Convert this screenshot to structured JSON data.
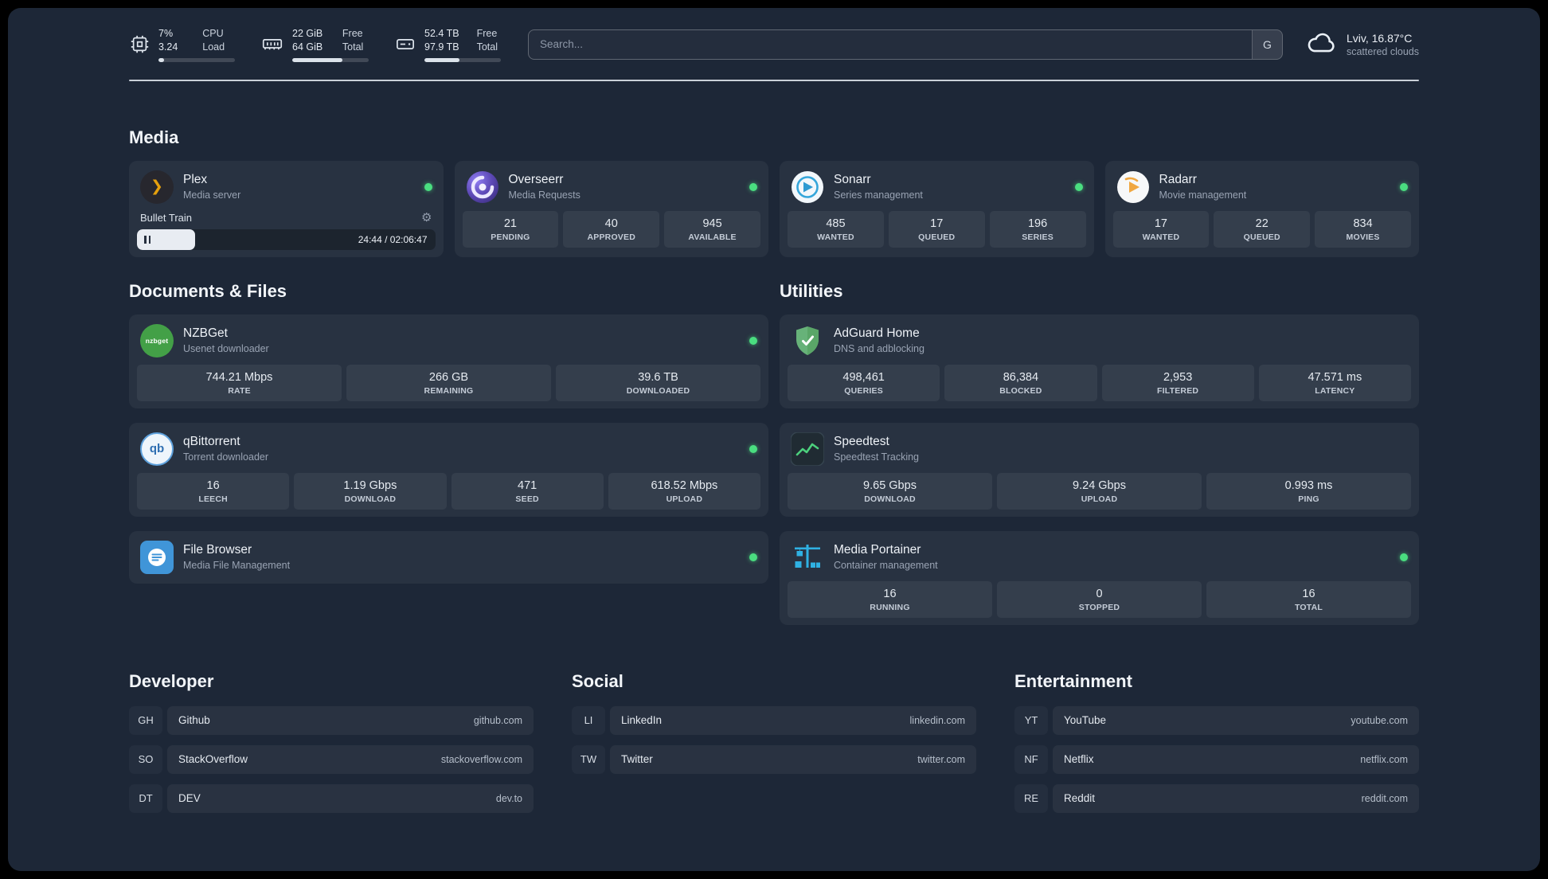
{
  "topbar": {
    "resources": [
      {
        "icon": "cpu-icon",
        "line1": "7%",
        "line2": "3.24",
        "label1": "CPU",
        "label2": "Load",
        "bar_pct": 7
      },
      {
        "icon": "ram-icon",
        "line1": "22 GiB",
        "line2": "64 GiB",
        "label1": "Free",
        "label2": "Total",
        "bar_pct": 66
      },
      {
        "icon": "disk-icon",
        "line1": "52.4 TB",
        "line2": "97.9 TB",
        "label1": "Free",
        "label2": "Total",
        "bar_pct": 46
      }
    ],
    "search": {
      "placeholder": "Search...",
      "provider_label": "G"
    },
    "weather": {
      "icon": "cloud-icon",
      "location": "Lviv, 16.87°C",
      "condition": "scattered clouds"
    }
  },
  "media": {
    "title": "Media",
    "plex": {
      "icon": "plex-icon",
      "name": "Plex",
      "subtitle": "Media server",
      "status": "online",
      "player": {
        "title": "Bullet Train",
        "time": "24:44 / 02:06:47",
        "progress_pct": 19.5
      }
    },
    "overseerr": {
      "icon": "overseerr-icon",
      "name": "Overseerr",
      "subtitle": "Media Requests",
      "status": "online",
      "stats": [
        {
          "value": "21",
          "label": "PENDING"
        },
        {
          "value": "40",
          "label": "APPROVED"
        },
        {
          "value": "945",
          "label": "AVAILABLE"
        }
      ]
    },
    "sonarr": {
      "icon": "sonarr-icon",
      "name": "Sonarr",
      "subtitle": "Series management",
      "status": "online",
      "stats": [
        {
          "value": "485",
          "label": "WANTED"
        },
        {
          "value": "17",
          "label": "QUEUED"
        },
        {
          "value": "196",
          "label": "SERIES"
        }
      ]
    },
    "radarr": {
      "icon": "radarr-icon",
      "name": "Radarr",
      "subtitle": "Movie management",
      "status": "online",
      "stats": [
        {
          "value": "17",
          "label": "WANTED"
        },
        {
          "value": "22",
          "label": "QUEUED"
        },
        {
          "value": "834",
          "label": "MOVIES"
        }
      ]
    }
  },
  "documents": {
    "title": "Documents & Files",
    "nzbget": {
      "icon": "nzbget-icon",
      "icon_text": "nzbget",
      "name": "NZBGet",
      "subtitle": "Usenet downloader",
      "status": "online",
      "stats": [
        {
          "value": "744.21 Mbps",
          "label": "RATE"
        },
        {
          "value": "266 GB",
          "label": "REMAINING"
        },
        {
          "value": "39.6 TB",
          "label": "DOWNLOADED"
        }
      ]
    },
    "qbittorrent": {
      "icon": "qbittorrent-icon",
      "icon_text": "qb",
      "name": "qBittorrent",
      "subtitle": "Torrent downloader",
      "status": "online",
      "stats": [
        {
          "value": "16",
          "label": "LEECH"
        },
        {
          "value": "1.19 Gbps",
          "label": "DOWNLOAD"
        },
        {
          "value": "471",
          "label": "SEED"
        },
        {
          "value": "618.52 Mbps",
          "label": "UPLOAD"
        }
      ]
    },
    "filebrowser": {
      "icon": "filebrowser-icon",
      "name": "File Browser",
      "subtitle": "Media File Management",
      "status": "online"
    }
  },
  "utilities": {
    "title": "Utilities",
    "adguard": {
      "icon": "adguard-icon",
      "name": "AdGuard Home",
      "subtitle": "DNS and adblocking",
      "stats": [
        {
          "value": "498,461",
          "label": "QUERIES"
        },
        {
          "value": "86,384",
          "label": "BLOCKED"
        },
        {
          "value": "2,953",
          "label": "FILTERED"
        },
        {
          "value": "47.571 ms",
          "label": "LATENCY"
        }
      ]
    },
    "speedtest": {
      "icon": "speedtest-icon",
      "name": "Speedtest",
      "subtitle": "Speedtest Tracking",
      "stats": [
        {
          "value": "9.65 Gbps",
          "label": "DOWNLOAD"
        },
        {
          "value": "9.24 Gbps",
          "label": "UPLOAD"
        },
        {
          "value": "0.993 ms",
          "label": "PING"
        }
      ]
    },
    "portainer": {
      "icon": "portainer-icon",
      "name": "Media Portainer",
      "subtitle": "Container management",
      "status": "online",
      "stats": [
        {
          "value": "16",
          "label": "RUNNING"
        },
        {
          "value": "0",
          "label": "STOPPED"
        },
        {
          "value": "16",
          "label": "TOTAL"
        }
      ]
    }
  },
  "bookmarks": [
    {
      "title": "Developer",
      "items": [
        {
          "abbr": "GH",
          "name": "Github",
          "domain": "github.com"
        },
        {
          "abbr": "SO",
          "name": "StackOverflow",
          "domain": "stackoverflow.com"
        },
        {
          "abbr": "DT",
          "name": "DEV",
          "domain": "dev.to"
        }
      ]
    },
    {
      "title": "Social",
      "items": [
        {
          "abbr": "LI",
          "name": "LinkedIn",
          "domain": "linkedin.com"
        },
        {
          "abbr": "TW",
          "name": "Twitter",
          "domain": "twitter.com"
        }
      ]
    },
    {
      "title": "Entertainment",
      "items": [
        {
          "abbr": "YT",
          "name": "YouTube",
          "domain": "youtube.com"
        },
        {
          "abbr": "NF",
          "name": "Netflix",
          "domain": "netflix.com"
        },
        {
          "abbr": "RE",
          "name": "Reddit",
          "domain": "reddit.com"
        }
      ]
    }
  ],
  "colors": {
    "background": "#1d2737",
    "status_online": "#4ade80",
    "plex_accent": "#e5a00d",
    "adguard_green": "#67b279",
    "portainer_blue": "#2fb1e3"
  }
}
